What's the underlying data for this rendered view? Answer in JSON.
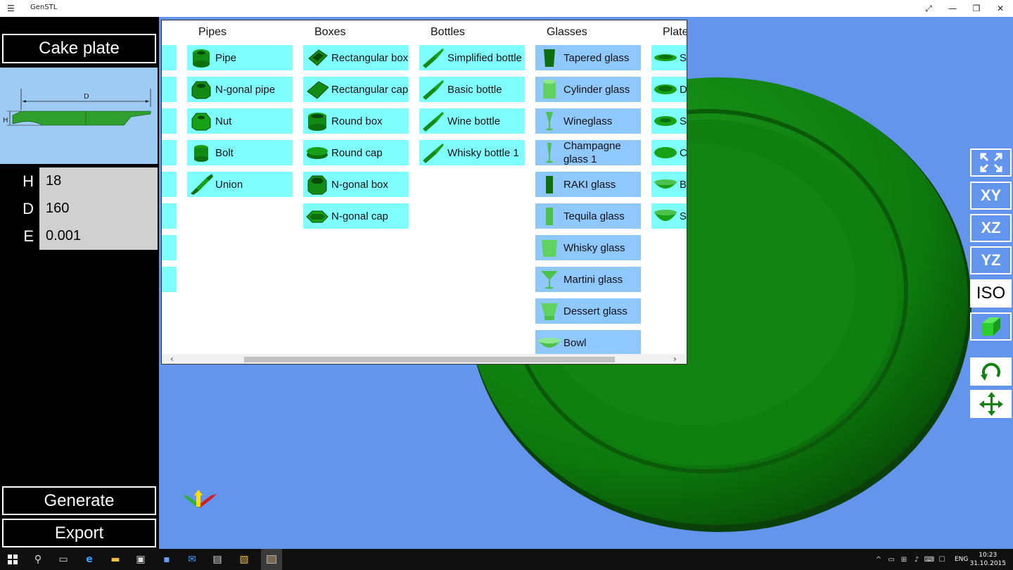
{
  "app": {
    "title": "GenSTL"
  },
  "left": {
    "model_name": "Cake plate",
    "diagram": {
      "label_d": "D",
      "label_h": "H"
    },
    "params": [
      {
        "label": "H",
        "value": "18"
      },
      {
        "label": "D",
        "value": "160"
      },
      {
        "label": "E",
        "value": "0.001"
      }
    ],
    "generate_label": "Generate",
    "export_label": "Export"
  },
  "catalog": {
    "columns": [
      {
        "header": "Pipes",
        "items": [
          "Pipe",
          "N-gonal pipe",
          "Nut",
          "Bolt",
          "Union"
        ]
      },
      {
        "header": "Boxes",
        "items": [
          "Rectangular box",
          "Rectangular cap",
          "Round box",
          "Round cap",
          "N-gonal box",
          "N-gonal cap"
        ]
      },
      {
        "header": "Bottles",
        "items": [
          "Simplified bottle",
          "Basic bottle",
          "Wine bottle",
          "Whisky bottle 1"
        ]
      },
      {
        "header": "Glasses",
        "items": [
          "Tapered glass",
          "Cylinder glass",
          "Wineglass",
          "Champagne glass 1",
          "RAKI glass",
          "Tequila glass",
          "Whisky glass",
          "Martini glass",
          "Dessert glass",
          "Bowl"
        ]
      },
      {
        "header": "Plate",
        "items": [
          "Sa",
          "D",
          "Sa",
          "C",
          "B",
          "Sa"
        ]
      }
    ]
  },
  "view_buttons": {
    "xy": "XY",
    "xz": "XZ",
    "yz": "YZ",
    "iso": "ISO"
  },
  "taskbar": {
    "lang": "ENG",
    "time": "10:23",
    "date": "31.10.2015"
  },
  "colors": {
    "viewport": "#6495ed",
    "plate": "#0d7a0d",
    "catalog_item_cyan": "#80ffff",
    "catalog_item_blue": "#8fc8ff"
  }
}
